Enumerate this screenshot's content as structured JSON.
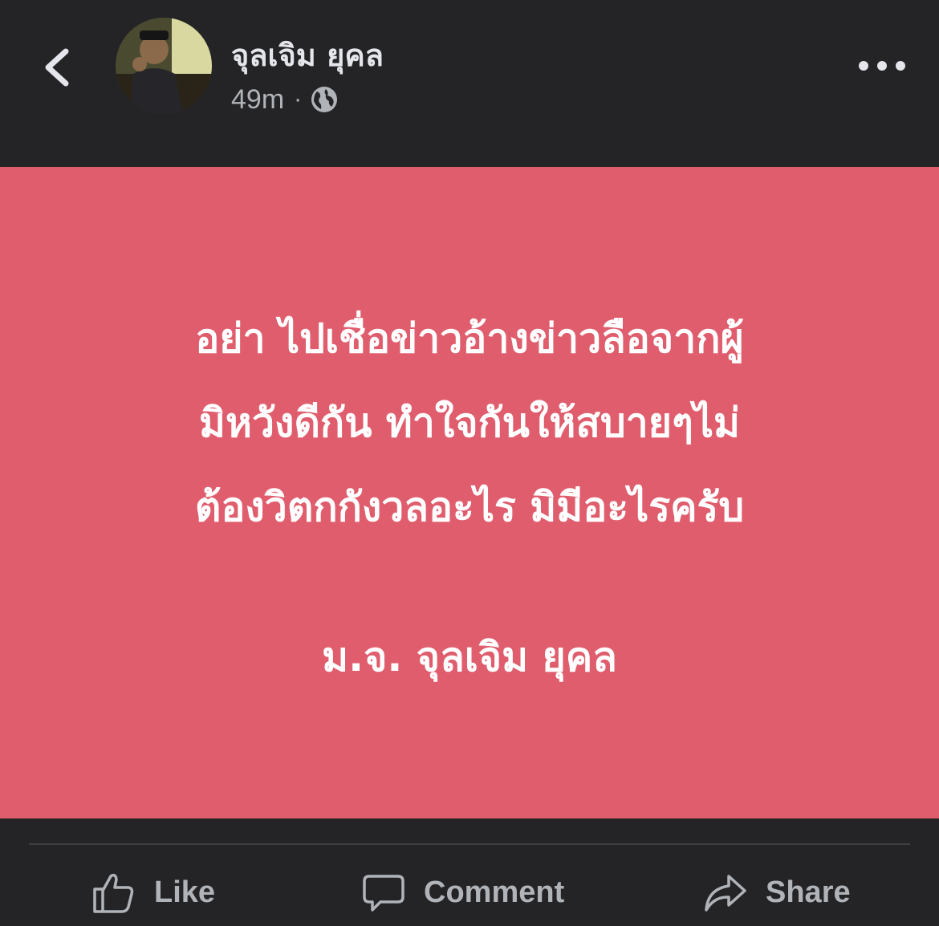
{
  "header": {
    "back_icon": "chevron-left-icon",
    "author_name": "จุลเจิม ยุคล",
    "timestamp": "49m",
    "separator": "·",
    "privacy_icon": "globe-icon",
    "more_icon": "more-horizontal-icon"
  },
  "post": {
    "background_color": "#e05d6d",
    "lines": [
      "อย่า ไปเชื่อข่าวอ้างข่าวลือจากผู้",
      "มิหวังดีกัน ทำใจกันให้สบายๆไม่",
      "ต้องวิตกกังวลอะไร มิมีอะไรครับ"
    ],
    "signature": "ม.จ. จุลเจิม ยุคล"
  },
  "actions": {
    "like_label": "Like",
    "comment_label": "Comment",
    "share_label": "Share"
  }
}
